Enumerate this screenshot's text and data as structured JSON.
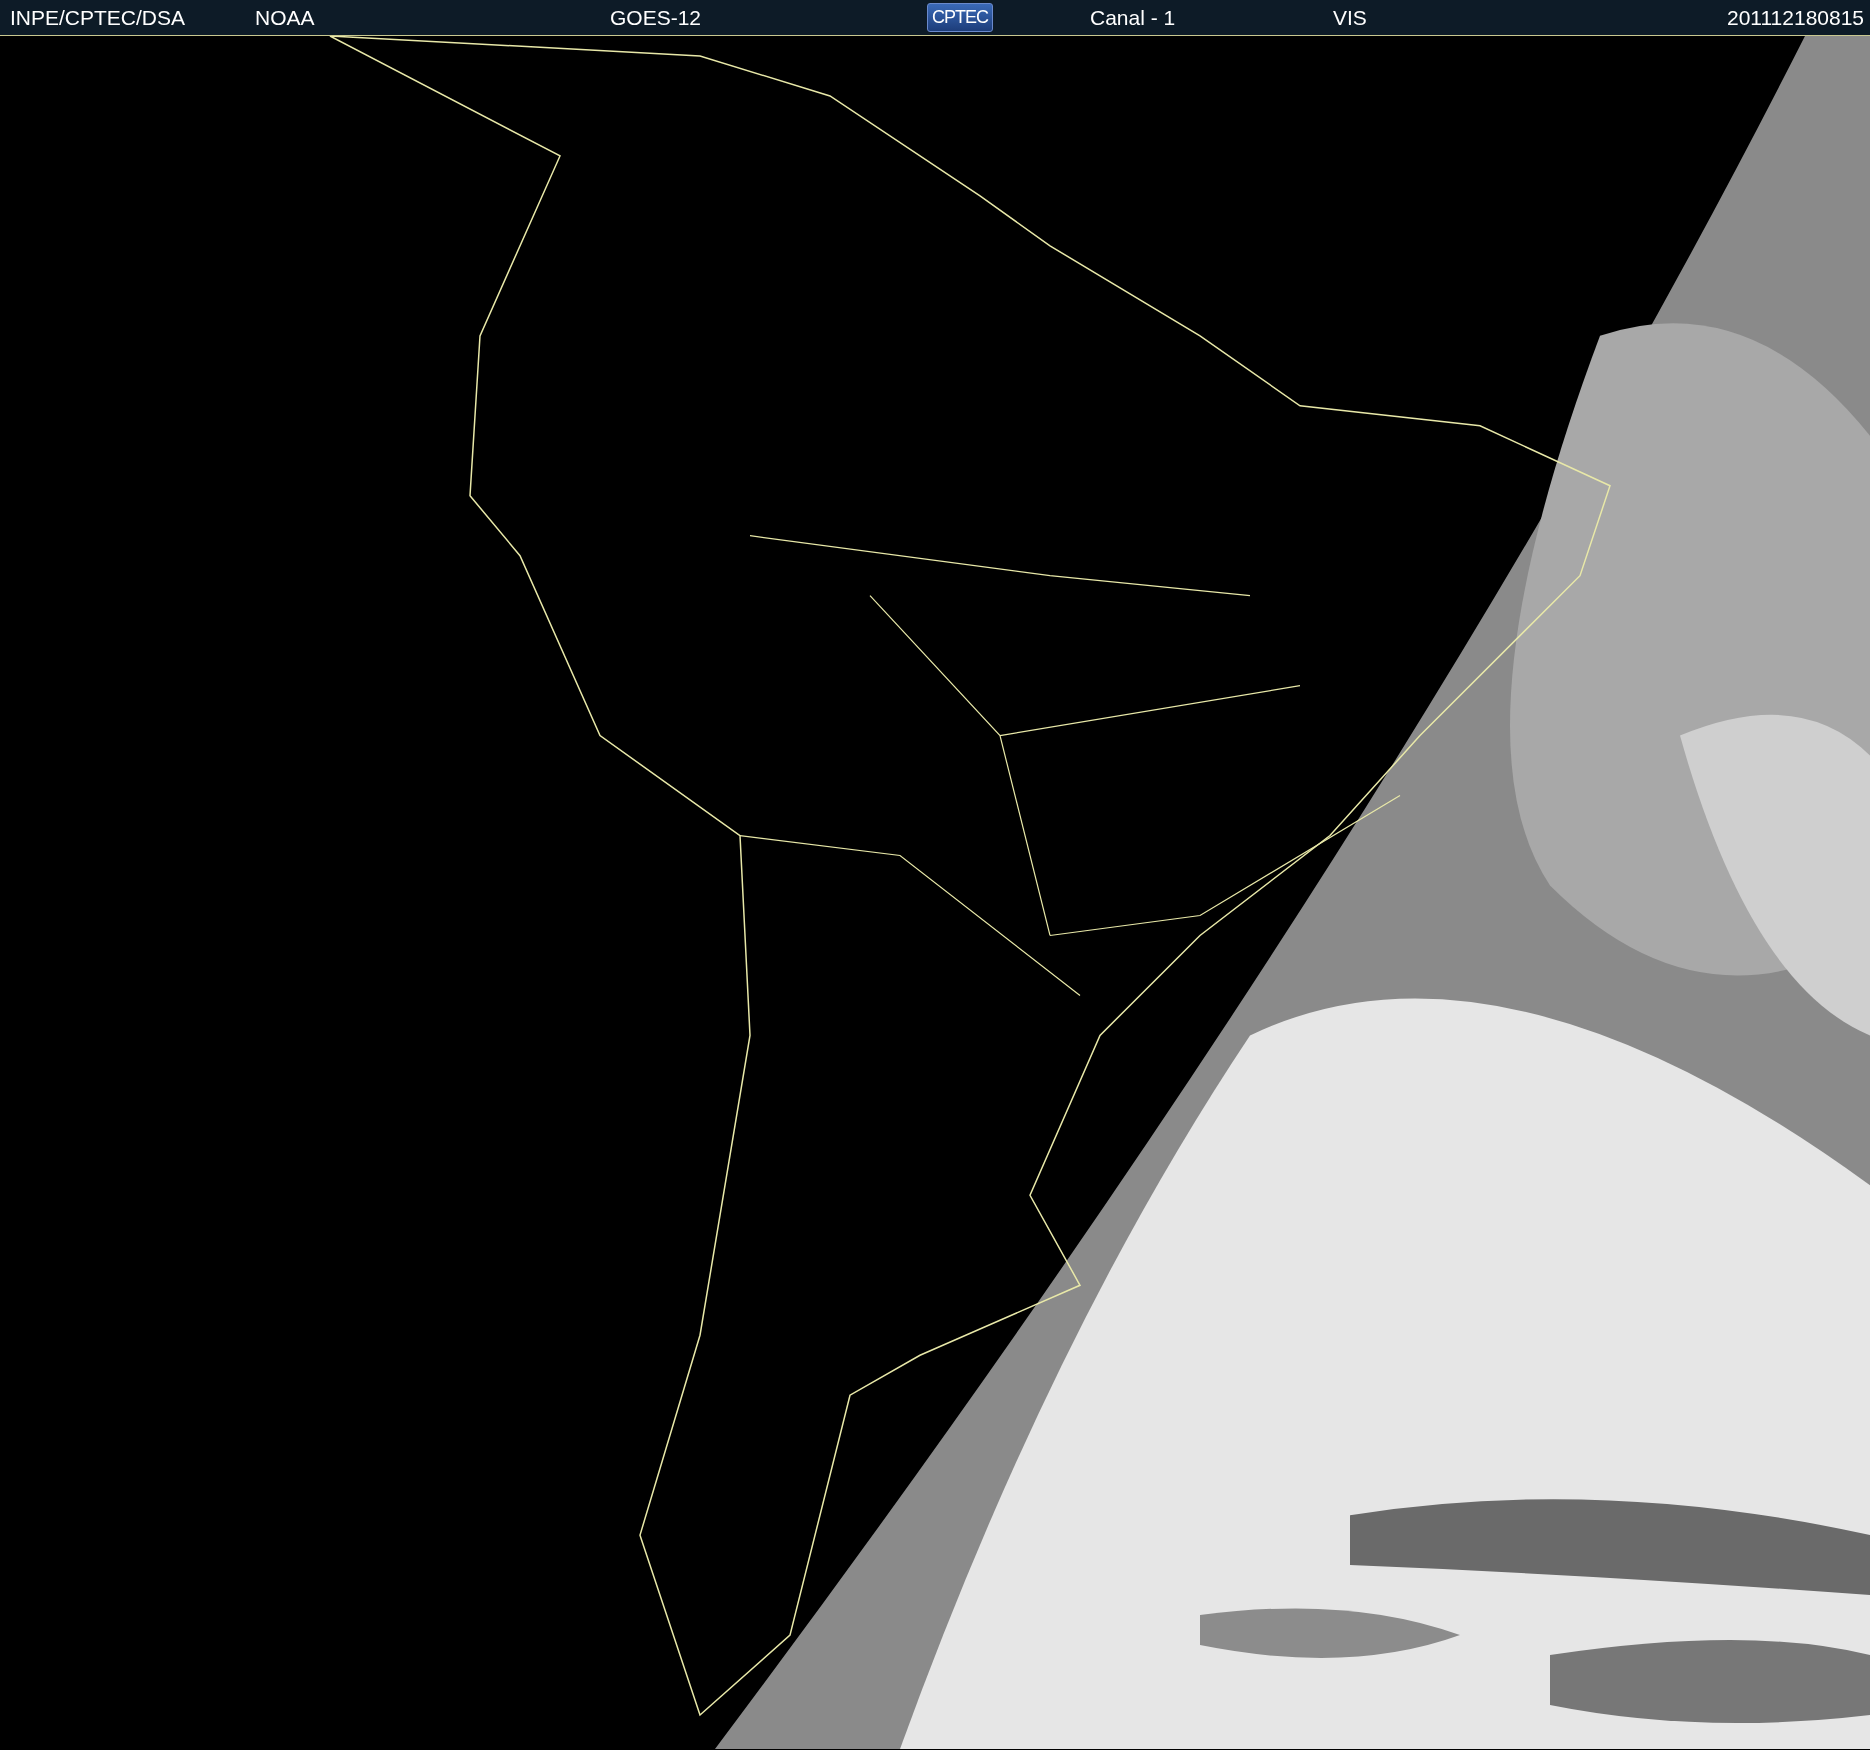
{
  "header": {
    "items": [
      "INPE/CPTEC/DSA",
      "NOAA",
      "GOES-12"
    ],
    "logo": "CPTEC",
    "channel": "Canal - 1",
    "band": "VIS",
    "timestamp": "201112180815"
  }
}
